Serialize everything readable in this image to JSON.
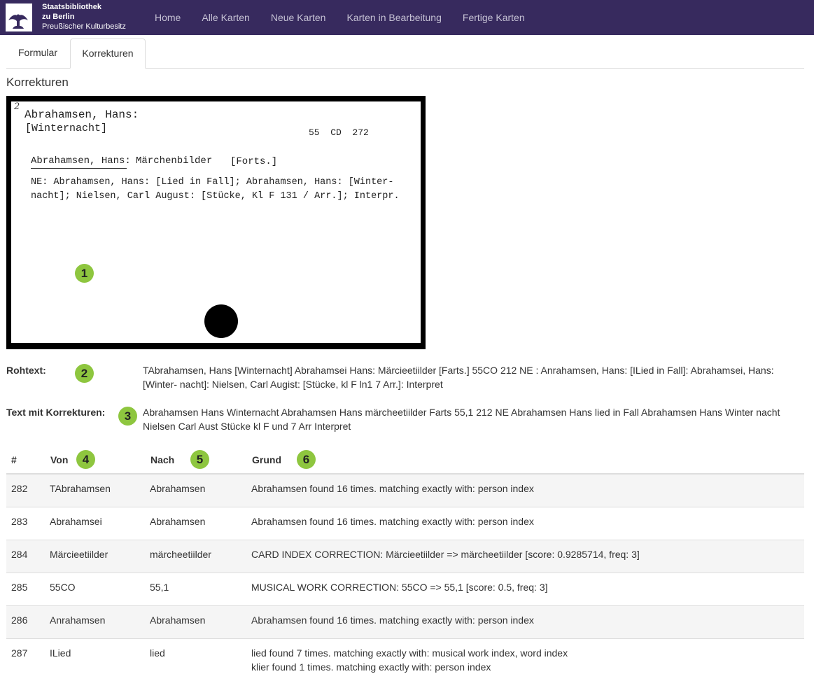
{
  "brand": {
    "line1": "Staatsbibliothek",
    "line2": "zu Berlin",
    "line3": "Preußischer Kulturbesitz",
    "logo_icon": "eagle-icon"
  },
  "nav": {
    "items": [
      {
        "label": "Home"
      },
      {
        "label": "Alle Karten"
      },
      {
        "label": "Neue Karten"
      },
      {
        "label": "Karten in Bearbeitung"
      },
      {
        "label": "Fertige Karten"
      }
    ]
  },
  "tabs": [
    {
      "label": "Formular",
      "active": false
    },
    {
      "label": "Korrekturen",
      "active": true
    }
  ],
  "page_title": "Korrekturen",
  "card": {
    "corner_mark": "2",
    "name": "Abrahamsen, Hans:",
    "title": "[Winternacht]",
    "signature": "55  CD  272",
    "ref_name": "Abrahamsen, Hans:",
    "ref_work": "Märchenbilder",
    "ref_forts": "[Forts.]",
    "ne_line1": "NE: Abrahamsen, Hans: [Lied in Fall]; Abrahamsen, Hans: [Winter-",
    "ne_line2": "nacht]; Nielsen, Carl August: [Stücke, Kl F 131 / Arr.]; Interpr."
  },
  "badges": [
    "1",
    "2",
    "3",
    "4",
    "5",
    "6"
  ],
  "rohtext": {
    "label": "Rohtext:",
    "line1": "TAbrahamsen, Hans [Winternacht] Abrahamsei Hans: Märcieetiilder [Farts.] 55CO 212 NE : Anrahamsen, Hans: [ILied in Fall]: Abrahamsei, Hans:",
    "line2": "[Winter- nacht]: Nielsen, Carl Augist: [Stücke, kl F ln1 7 Arr.]: Interpret"
  },
  "korrigiert": {
    "label": "Text mit Korrekturen:",
    "line1": "Abrahamsen Hans Winternacht Abrahamsen Hans märcheetiilder Farts 55,1 212 NE Abrahamsen Hans lied in Fall Abrahamsen Hans Winter nacht",
    "line2": "Nielsen Carl Aust Stücke kl F und 7 Arr Interpret"
  },
  "table": {
    "headers": {
      "num": "#",
      "von": "Von",
      "nach": "Nach",
      "grund": "Grund"
    },
    "rows": [
      {
        "num": "282",
        "von": "TAbrahamsen",
        "nach": "Abrahamsen",
        "grund": "Abrahamsen found 16 times. matching exactly with: person index",
        "grund2": ""
      },
      {
        "num": "283",
        "von": "Abrahamsei",
        "nach": "Abrahamsen",
        "grund": "Abrahamsen found 16 times. matching exactly with: person index",
        "grund2": ""
      },
      {
        "num": "284",
        "von": "Märcieetiilder",
        "nach": "märcheetiilder",
        "grund": "CARD INDEX CORRECTION: Märcieetiilder => märcheetiilder [score: 0.9285714, freq: 3]",
        "grund2": ""
      },
      {
        "num": "285",
        "von": "55CO",
        "nach": "55,1",
        "grund": "MUSICAL WORK CORRECTION: 55CO => 55,1 [score: 0.5, freq: 3]",
        "grund2": ""
      },
      {
        "num": "286",
        "von": "Anrahamsen",
        "nach": "Abrahamsen",
        "grund": "Abrahamsen found 16 times. matching exactly with: person index",
        "grund2": ""
      },
      {
        "num": "287",
        "von": "ILied",
        "nach": "lied",
        "grund": "lied found 7 times. matching exactly with: musical work index, word index",
        "grund2": "klier found 1 times. matching exactly with: person index"
      }
    ]
  }
}
